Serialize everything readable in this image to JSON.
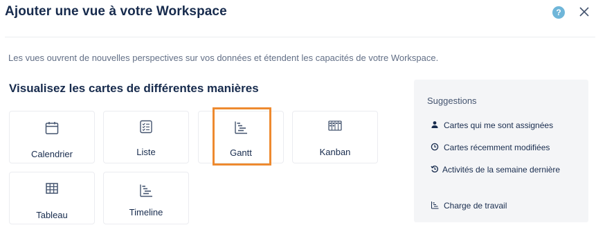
{
  "modal": {
    "title": "Ajouter une vue à votre Workspace",
    "help_glyph": "?",
    "close_glyph": "×",
    "description": "Les vues ouvrent de nouvelles perspectives sur vos données et étendent les capacités de votre Workspace."
  },
  "section": {
    "title": "Visualisez les cartes de différentes manières"
  },
  "views": [
    {
      "label": "Calendrier",
      "icon": "calendar-icon"
    },
    {
      "label": "Liste",
      "icon": "checklist-icon"
    },
    {
      "label": "Gantt",
      "icon": "gantt-icon"
    },
    {
      "label": "Kanban",
      "icon": "kanban-icon"
    },
    {
      "label": "Tableau",
      "icon": "table-icon"
    },
    {
      "label": "Timeline",
      "icon": "timeline-icon"
    }
  ],
  "suggestions": {
    "title": "Suggestions",
    "items": [
      {
        "label": "Cartes qui me sont assignées",
        "icon": "person-icon"
      },
      {
        "label": "Cartes récemment modifiées",
        "icon": "clock-icon"
      },
      {
        "label": "Activités de la semaine dernière",
        "icon": "history-icon"
      },
      {
        "label": "Charge de travail",
        "icon": "workload-icon"
      }
    ]
  },
  "colors": {
    "highlight": "#ee8a2f",
    "help": "#6fb6d9",
    "panel": "#f4f5f7"
  }
}
